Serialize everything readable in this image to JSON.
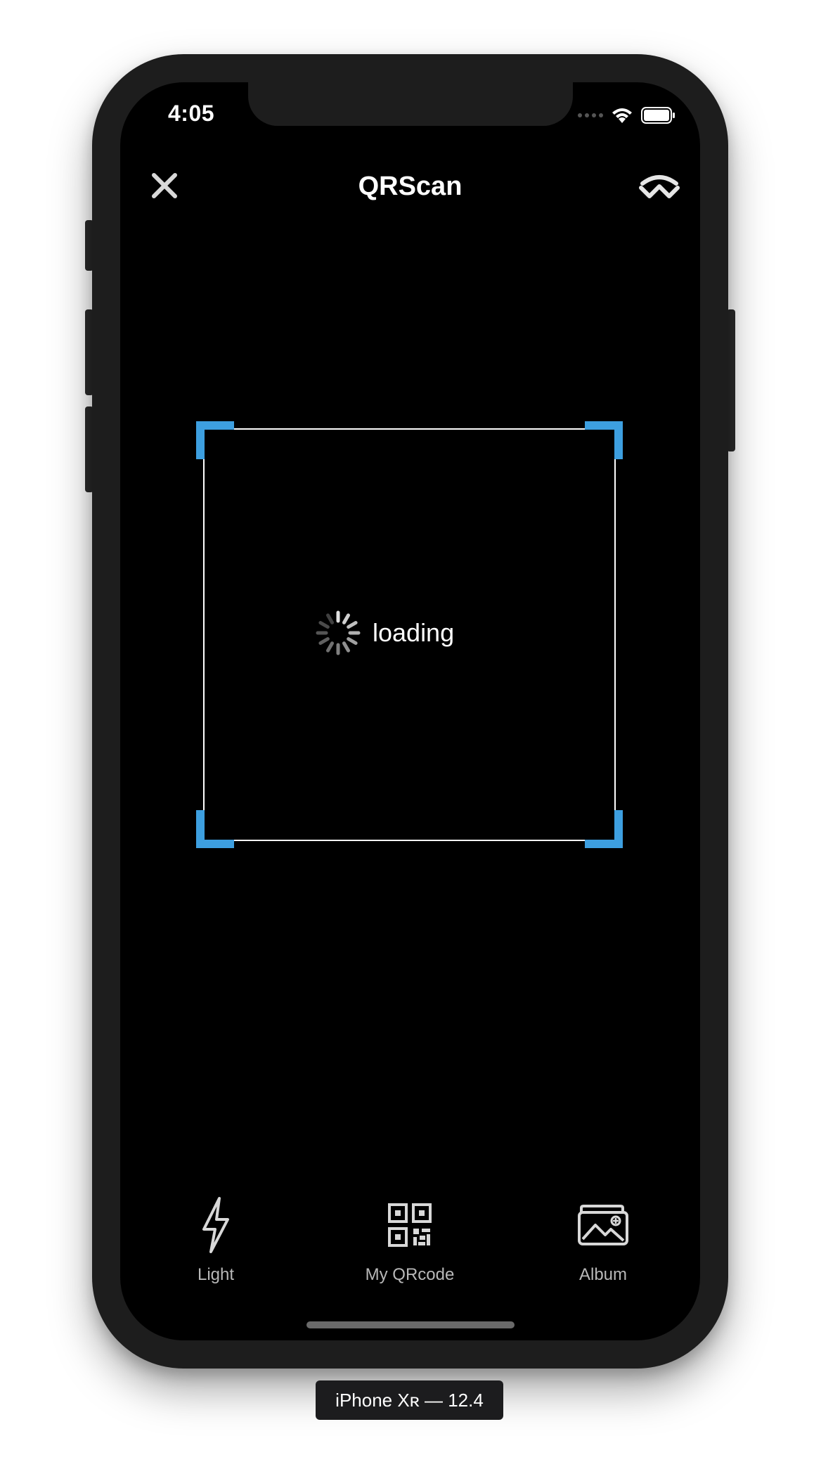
{
  "status_bar": {
    "time": "4:05"
  },
  "nav": {
    "title": "QRScan",
    "close_icon": "close-icon",
    "brand_icon": "walletconnect-icon"
  },
  "scanner": {
    "loading_text": "loading",
    "accent_color": "#3d9fe0",
    "frame_color": "#ffffff"
  },
  "toolbar": {
    "items": [
      {
        "label": "Light",
        "icon": "lightning-icon"
      },
      {
        "label": "My QRcode",
        "icon": "qrcode-icon"
      },
      {
        "label": "Album",
        "icon": "album-icon"
      }
    ]
  },
  "device": {
    "label": "iPhone Xʀ — 12.4"
  }
}
